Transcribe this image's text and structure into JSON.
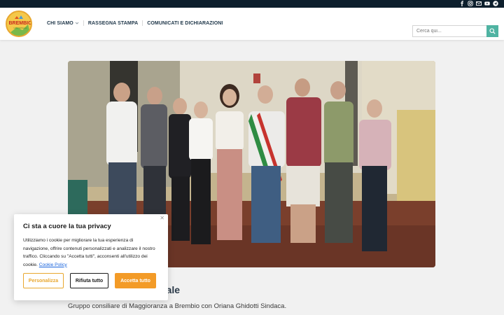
{
  "logo": {
    "text": "BREMBIO",
    "sub": "UNIVERSALE"
  },
  "social_icons": [
    "facebook-icon",
    "instagram-icon",
    "mail-icon",
    "youtube-icon",
    "telegram-icon"
  ],
  "nav": {
    "items": [
      {
        "label": "CHI SIAMO",
        "has_dropdown": true
      },
      {
        "label": "RASSEGNA STAMPA"
      },
      {
        "label": "COMUNICATI E DICHIARAZIONI"
      }
    ]
  },
  "search": {
    "placeholder": "Cerca qui...",
    "value": ""
  },
  "colors": {
    "topbar": "#0d1f2d",
    "accent": "#4fb3a2",
    "orange": "#f39b27",
    "link": "#1863dc"
  },
  "main": {
    "title": "dale",
    "subtitle": "Gruppo consiliare di Maggioranza a Brembio con Oriana Ghidotti Sindaca."
  },
  "cookie": {
    "title": "Ci sta a cuore la tua privacy",
    "text": "Utilizziamo i cookie per migliorare la tua esperienza di navigazione, offrire contenuti personalizzati e analizzare il nostro traffico. Cliccando su \"Accetta tutti\", acconsenti all'utilizzo dei cookie.",
    "policy_link": "Cookie Policy",
    "buttons": {
      "customize": "Personalizza",
      "reject": "Rifiuta tutto",
      "accept": "Accetta tutto"
    }
  }
}
